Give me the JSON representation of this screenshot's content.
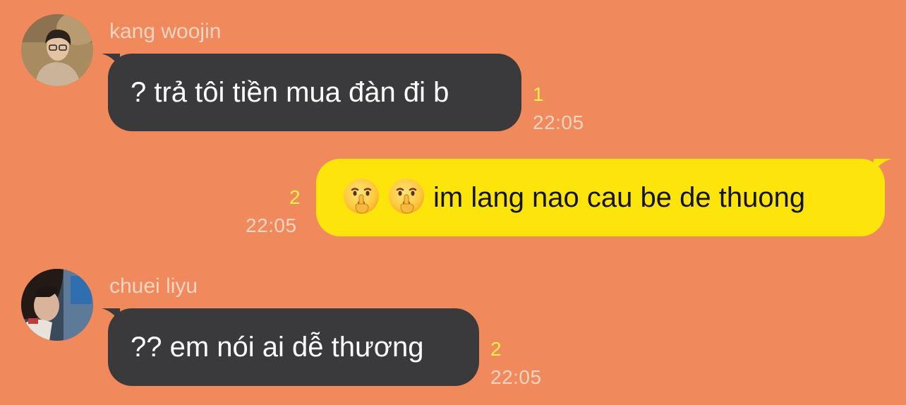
{
  "colors": {
    "background": "#F0895C",
    "incoming_bubble": "#3A3A3C",
    "outgoing_bubble": "#FDE50C",
    "unread_count": "#FFF04C",
    "meta_text": "#F9D5C2"
  },
  "messages": [
    {
      "direction": "incoming",
      "sender": "kang woojin",
      "avatar": "profile-photo",
      "text": "? trả tôi tiền mua đàn đi b",
      "unread": "1",
      "time": "22:05"
    },
    {
      "direction": "outgoing",
      "emoji": [
        "shushing-face-emoji",
        "shushing-face-emoji"
      ],
      "text": "im lang nao cau be de thuong",
      "unread": "2",
      "time": "22:05"
    },
    {
      "direction": "incoming",
      "sender": "chuei liyu",
      "avatar": "profile-photo",
      "text": "?? em nói ai dễ thương",
      "unread": "2",
      "time": "22:05"
    }
  ]
}
